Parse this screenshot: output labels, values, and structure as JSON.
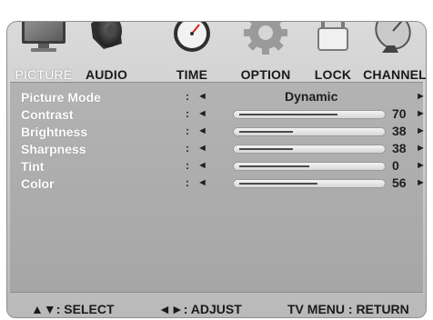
{
  "tabs": [
    {
      "label": "PICTURE",
      "icon": "monitor-icon",
      "active": true
    },
    {
      "label": "AUDIO",
      "icon": "speaker-icon",
      "active": false
    },
    {
      "label": "TIME",
      "icon": "stopwatch-icon",
      "active": false
    },
    {
      "label": "OPTION",
      "icon": "gear-icon",
      "active": false
    },
    {
      "label": "LOCK",
      "icon": "padlock-icon",
      "active": false
    },
    {
      "label": "CHANNEL",
      "icon": "satellite-dish-icon",
      "active": false
    }
  ],
  "menu": {
    "separator": ":",
    "left_arrow": "◄",
    "right_arrow": "►",
    "items": [
      {
        "label": "Picture Mode",
        "value": "Dynamic"
      },
      {
        "label": "Contrast",
        "level": 70
      },
      {
        "label": "Brightness",
        "level": 38
      },
      {
        "label": "Sharpness",
        "level": 38
      },
      {
        "label": "Tint",
        "level": 0
      },
      {
        "label": "Color",
        "level": 56
      }
    ]
  },
  "footer": {
    "select": "▲▼: SELECT",
    "adjust": "◄►: ADJUST",
    "return": "TV MENU : RETURN"
  },
  "colors": {
    "background": "#bdbdbd",
    "label_text": "#ffffff",
    "value_text": "#1e1e1e"
  }
}
